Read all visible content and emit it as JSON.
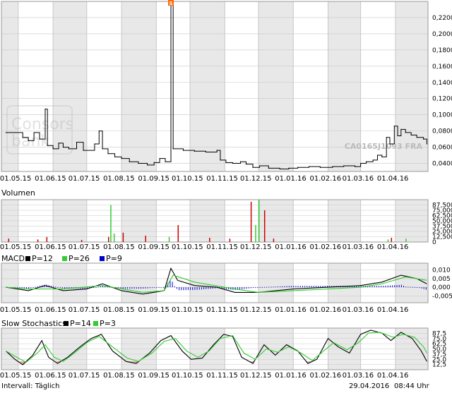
{
  "watermark": {
    "brand_line1": "Consors",
    "brand_line2": "bank",
    "security_id": "CA0165J1093 FRA"
  },
  "x_axis": {
    "labels": [
      "01.05.15",
      "01.06.15",
      "01.07.15",
      "01.08.15",
      "01.09.15",
      "01.10.15",
      "01.11.15",
      "01.12.15",
      "01.01.16",
      "01.02.16",
      "01.03.16",
      "01.04.16"
    ]
  },
  "footer": {
    "interval": "Intervall: Täglich",
    "date": "29.04.2016",
    "time": "08:44 Uhr"
  },
  "colors": {
    "band": "#e8e8e8",
    "grid": "#c8c8c8",
    "price": "#000000",
    "volume": "#cc0000",
    "volume_alt": "#33cc33",
    "macd": "#000000",
    "macd_signal": "#33cc33",
    "macd_hist": "#0000cc",
    "stoch_fill": "#ddaaaa",
    "event_marker": "#ff6600"
  },
  "chart_data": [
    {
      "type": "line",
      "panel": "price",
      "ylim": [
        0.03,
        0.24
      ],
      "y_ticks": [
        "0,2200",
        "0,2000",
        "0,1800",
        "0,1600",
        "0,1400",
        "0,1200",
        "0,1000",
        "0,0800",
        "0,0600",
        "0,0400"
      ],
      "event_marker": {
        "label": "S",
        "x": "2015-09-14"
      },
      "series": [
        {
          "x": "2015-04-20",
          "y": 0.078
        },
        {
          "x": "2015-05-05",
          "y": 0.072
        },
        {
          "x": "2015-05-10",
          "y": 0.068
        },
        {
          "x": "2015-05-15",
          "y": 0.078
        },
        {
          "x": "2015-05-20",
          "y": 0.07
        },
        {
          "x": "2015-05-25",
          "y": 0.107
        },
        {
          "x": "2015-05-27",
          "y": 0.062
        },
        {
          "x": "2015-06-01",
          "y": 0.058
        },
        {
          "x": "2015-06-06",
          "y": 0.065
        },
        {
          "x": "2015-06-10",
          "y": 0.06
        },
        {
          "x": "2015-06-15",
          "y": 0.058
        },
        {
          "x": "2015-06-22",
          "y": 0.066
        },
        {
          "x": "2015-06-28",
          "y": 0.056
        },
        {
          "x": "2015-07-08",
          "y": 0.064
        },
        {
          "x": "2015-07-12",
          "y": 0.08
        },
        {
          "x": "2015-07-15",
          "y": 0.058
        },
        {
          "x": "2015-07-20",
          "y": 0.052
        },
        {
          "x": "2015-07-26",
          "y": 0.048
        },
        {
          "x": "2015-08-01",
          "y": 0.046
        },
        {
          "x": "2015-08-08",
          "y": 0.042
        },
        {
          "x": "2015-08-16",
          "y": 0.04
        },
        {
          "x": "2015-08-24",
          "y": 0.038
        },
        {
          "x": "2015-08-30",
          "y": 0.041
        },
        {
          "x": "2015-09-04",
          "y": 0.046
        },
        {
          "x": "2015-09-09",
          "y": 0.042
        },
        {
          "x": "2015-09-14",
          "y": 0.236
        },
        {
          "x": "2015-09-16",
          "y": 0.058
        },
        {
          "x": "2015-09-25",
          "y": 0.056
        },
        {
          "x": "2015-10-05",
          "y": 0.055
        },
        {
          "x": "2015-10-15",
          "y": 0.054
        },
        {
          "x": "2015-10-25",
          "y": 0.056
        },
        {
          "x": "2015-10-28",
          "y": 0.044
        },
        {
          "x": "2015-11-02",
          "y": 0.041
        },
        {
          "x": "2015-11-08",
          "y": 0.04
        },
        {
          "x": "2015-11-15",
          "y": 0.042
        },
        {
          "x": "2015-11-20",
          "y": 0.039
        },
        {
          "x": "2015-11-26",
          "y": 0.035
        },
        {
          "x": "2015-12-02",
          "y": 0.037
        },
        {
          "x": "2015-12-10",
          "y": 0.034
        },
        {
          "x": "2015-12-20",
          "y": 0.033
        },
        {
          "x": "2015-12-28",
          "y": 0.034
        },
        {
          "x": "2016-01-05",
          "y": 0.035
        },
        {
          "x": "2016-01-15",
          "y": 0.036
        },
        {
          "x": "2016-01-25",
          "y": 0.035
        },
        {
          "x": "2016-02-05",
          "y": 0.036
        },
        {
          "x": "2016-02-15",
          "y": 0.037
        },
        {
          "x": "2016-02-25",
          "y": 0.036
        },
        {
          "x": "2016-03-01",
          "y": 0.04
        },
        {
          "x": "2016-03-06",
          "y": 0.042
        },
        {
          "x": "2016-03-12",
          "y": 0.044
        },
        {
          "x": "2016-03-16",
          "y": 0.05
        },
        {
          "x": "2016-03-20",
          "y": 0.048
        },
        {
          "x": "2016-03-24",
          "y": 0.072
        },
        {
          "x": "2016-03-27",
          "y": 0.064
        },
        {
          "x": "2016-03-31",
          "y": 0.086
        },
        {
          "x": "2016-04-03",
          "y": 0.074
        },
        {
          "x": "2016-04-06",
          "y": 0.082
        },
        {
          "x": "2016-04-10",
          "y": 0.078
        },
        {
          "x": "2016-04-15",
          "y": 0.075
        },
        {
          "x": "2016-04-20",
          "y": 0.072
        },
        {
          "x": "2016-04-26",
          "y": 0.07
        },
        {
          "x": "2016-04-29",
          "y": 0.064
        }
      ]
    },
    {
      "type": "bar",
      "panel": "volume",
      "title": "Volumen",
      "ylim": [
        0,
        100000
      ],
      "y_ticks": [
        "87,500",
        "75,000",
        "62,500",
        "50,000",
        "37,500",
        "25,000",
        "12,500",
        "0"
      ],
      "bars": [
        {
          "x": "2015-04-22",
          "v": 8000,
          "c": "red"
        },
        {
          "x": "2015-05-18",
          "v": 6000,
          "c": "red"
        },
        {
          "x": "2015-05-26",
          "v": 12000,
          "c": "red"
        },
        {
          "x": "2015-06-26",
          "v": 5000,
          "c": "red"
        },
        {
          "x": "2015-07-20",
          "v": 12000,
          "c": "red"
        },
        {
          "x": "2015-07-22",
          "v": 87500,
          "c": "green"
        },
        {
          "x": "2015-07-25",
          "v": 20000,
          "c": "green"
        },
        {
          "x": "2015-08-02",
          "v": 22000,
          "c": "red"
        },
        {
          "x": "2015-08-22",
          "v": 15000,
          "c": "red"
        },
        {
          "x": "2015-09-12",
          "v": 12000,
          "c": "green"
        },
        {
          "x": "2015-09-20",
          "v": 40000,
          "c": "red"
        },
        {
          "x": "2015-10-18",
          "v": 10000,
          "c": "red"
        },
        {
          "x": "2015-11-05",
          "v": 8000,
          "c": "red"
        },
        {
          "x": "2015-11-24",
          "v": 95000,
          "c": "red"
        },
        {
          "x": "2015-11-28",
          "v": 40000,
          "c": "green"
        },
        {
          "x": "2015-12-01",
          "v": 118000,
          "c": "green"
        },
        {
          "x": "2015-12-06",
          "v": 75000,
          "c": "red"
        },
        {
          "x": "2015-12-14",
          "v": 8000,
          "c": "red"
        },
        {
          "x": "2016-03-25",
          "v": 6000,
          "c": "green"
        },
        {
          "x": "2016-03-28",
          "v": 10000,
          "c": "red"
        },
        {
          "x": "2016-04-10",
          "v": 8000,
          "c": "green"
        }
      ]
    },
    {
      "type": "line",
      "panel": "macd",
      "title": "MACD",
      "legend": [
        {
          "name": "P=12",
          "color": "#000000"
        },
        {
          "name": "P=26",
          "color": "#33cc33"
        },
        {
          "name": "P=9",
          "color": "#0000cc"
        }
      ],
      "ylim": [
        -0.009,
        0.014
      ],
      "y_ticks": [
        "0,010",
        "0,005",
        "0,000",
        "-0,005"
      ],
      "series": [
        {
          "name": "P=12",
          "color": "#000000",
          "points": [
            {
              "x": "2015-04-20",
              "y": 0.0
            },
            {
              "x": "2015-05-10",
              "y": -0.002
            },
            {
              "x": "2015-05-25",
              "y": 0.001
            },
            {
              "x": "2015-06-10",
              "y": -0.002
            },
            {
              "x": "2015-07-01",
              "y": -0.001
            },
            {
              "x": "2015-07-15",
              "y": 0.002
            },
            {
              "x": "2015-08-01",
              "y": -0.002
            },
            {
              "x": "2015-08-20",
              "y": -0.004
            },
            {
              "x": "2015-09-08",
              "y": -0.002
            },
            {
              "x": "2015-09-14",
              "y": 0.011
            },
            {
              "x": "2015-09-20",
              "y": 0.004
            },
            {
              "x": "2015-10-05",
              "y": 0.001
            },
            {
              "x": "2015-10-25",
              "y": 0.0
            },
            {
              "x": "2015-11-10",
              "y": -0.003
            },
            {
              "x": "2015-12-01",
              "y": -0.003
            },
            {
              "x": "2016-01-01",
              "y": -0.001
            },
            {
              "x": "2016-02-01",
              "y": 0.0
            },
            {
              "x": "2016-03-01",
              "y": 0.001
            },
            {
              "x": "2016-03-20",
              "y": 0.003
            },
            {
              "x": "2016-04-06",
              "y": 0.007
            },
            {
              "x": "2016-04-20",
              "y": 0.005
            },
            {
              "x": "2016-04-29",
              "y": 0.002
            }
          ]
        },
        {
          "name": "P=26",
          "color": "#33cc33",
          "points": [
            {
              "x": "2015-04-20",
              "y": 0.0
            },
            {
              "x": "2015-05-10",
              "y": -0.001
            },
            {
              "x": "2015-06-10",
              "y": -0.001
            },
            {
              "x": "2015-07-15",
              "y": 0.001
            },
            {
              "x": "2015-08-20",
              "y": -0.003
            },
            {
              "x": "2015-09-08",
              "y": -0.002
            },
            {
              "x": "2015-09-16",
              "y": 0.007
            },
            {
              "x": "2015-10-05",
              "y": 0.003
            },
            {
              "x": "2015-11-10",
              "y": -0.001
            },
            {
              "x": "2015-12-01",
              "y": -0.003
            },
            {
              "x": "2016-01-01",
              "y": -0.002
            },
            {
              "x": "2016-02-01",
              "y": -0.001
            },
            {
              "x": "2016-03-01",
              "y": 0.0
            },
            {
              "x": "2016-03-20",
              "y": 0.002
            },
            {
              "x": "2016-04-10",
              "y": 0.006
            },
            {
              "x": "2016-04-29",
              "y": 0.004
            }
          ]
        }
      ]
    },
    {
      "type": "line",
      "panel": "stochastics",
      "title": "Slow Stochastics",
      "legend": [
        {
          "name": "P=14",
          "color": "#000000"
        },
        {
          "name": "P=3",
          "color": "#33cc33"
        }
      ],
      "ylim": [
        0,
        100
      ],
      "y_ticks": [
        "87,5",
        "75,0",
        "62,5",
        "50,0",
        "37,5",
        "25,0",
        "12,5"
      ],
      "series": [
        {
          "name": "P=14",
          "color": "#000000",
          "points": [
            {
              "x": "2015-04-20",
              "y": 45
            },
            {
              "x": "2015-04-28",
              "y": 25
            },
            {
              "x": "2015-05-05",
              "y": 12
            },
            {
              "x": "2015-05-14",
              "y": 35
            },
            {
              "x": "2015-05-22",
              "y": 70
            },
            {
              "x": "2015-05-28",
              "y": 30
            },
            {
              "x": "2015-06-05",
              "y": 15
            },
            {
              "x": "2015-06-14",
              "y": 30
            },
            {
              "x": "2015-06-25",
              "y": 55
            },
            {
              "x": "2015-07-05",
              "y": 75
            },
            {
              "x": "2015-07-14",
              "y": 85
            },
            {
              "x": "2015-07-24",
              "y": 45
            },
            {
              "x": "2015-08-05",
              "y": 20
            },
            {
              "x": "2015-08-14",
              "y": 15
            },
            {
              "x": "2015-08-26",
              "y": 40
            },
            {
              "x": "2015-09-05",
              "y": 70
            },
            {
              "x": "2015-09-14",
              "y": 82
            },
            {
              "x": "2015-09-24",
              "y": 45
            },
            {
              "x": "2015-10-02",
              "y": 25
            },
            {
              "x": "2015-10-12",
              "y": 28
            },
            {
              "x": "2015-10-22",
              "y": 60
            },
            {
              "x": "2015-10-31",
              "y": 85
            },
            {
              "x": "2015-11-08",
              "y": 80
            },
            {
              "x": "2015-11-16",
              "y": 30
            },
            {
              "x": "2015-11-26",
              "y": 15
            },
            {
              "x": "2015-12-06",
              "y": 60
            },
            {
              "x": "2015-12-16",
              "y": 35
            },
            {
              "x": "2015-12-26",
              "y": 60
            },
            {
              "x": "2016-01-05",
              "y": 45
            },
            {
              "x": "2016-01-14",
              "y": 15
            },
            {
              "x": "2016-01-22",
              "y": 25
            },
            {
              "x": "2016-02-01",
              "y": 75
            },
            {
              "x": "2016-02-10",
              "y": 55
            },
            {
              "x": "2016-02-20",
              "y": 40
            },
            {
              "x": "2016-03-01",
              "y": 85
            },
            {
              "x": "2016-03-10",
              "y": 95
            },
            {
              "x": "2016-03-20",
              "y": 88
            },
            {
              "x": "2016-03-28",
              "y": 70
            },
            {
              "x": "2016-04-06",
              "y": 90
            },
            {
              "x": "2016-04-16",
              "y": 75
            },
            {
              "x": "2016-04-24",
              "y": 45
            },
            {
              "x": "2016-04-29",
              "y": 20
            }
          ]
        },
        {
          "name": "P=3",
          "color": "#33cc33",
          "points": [
            {
              "x": "2015-04-20",
              "y": 45
            },
            {
              "x": "2015-05-01",
              "y": 28
            },
            {
              "x": "2015-05-08",
              "y": 18
            },
            {
              "x": "2015-05-18",
              "y": 40
            },
            {
              "x": "2015-05-25",
              "y": 60
            },
            {
              "x": "2015-06-02",
              "y": 30
            },
            {
              "x": "2015-06-10",
              "y": 20
            },
            {
              "x": "2015-06-20",
              "y": 40
            },
            {
              "x": "2015-07-01",
              "y": 65
            },
            {
              "x": "2015-07-12",
              "y": 80
            },
            {
              "x": "2015-07-24",
              "y": 55
            },
            {
              "x": "2015-08-06",
              "y": 28
            },
            {
              "x": "2015-08-16",
              "y": 20
            },
            {
              "x": "2015-08-28",
              "y": 40
            },
            {
              "x": "2015-09-08",
              "y": 68
            },
            {
              "x": "2015-09-18",
              "y": 75
            },
            {
              "x": "2015-09-28",
              "y": 45
            },
            {
              "x": "2015-10-08",
              "y": 30
            },
            {
              "x": "2015-10-18",
              "y": 45
            },
            {
              "x": "2015-10-28",
              "y": 75
            },
            {
              "x": "2015-11-08",
              "y": 82
            },
            {
              "x": "2015-11-18",
              "y": 40
            },
            {
              "x": "2015-11-28",
              "y": 25
            },
            {
              "x": "2015-12-08",
              "y": 50
            },
            {
              "x": "2015-12-18",
              "y": 42
            },
            {
              "x": "2015-12-28",
              "y": 55
            },
            {
              "x": "2016-01-08",
              "y": 40
            },
            {
              "x": "2016-01-18",
              "y": 22
            },
            {
              "x": "2016-01-28",
              "y": 45
            },
            {
              "x": "2016-02-06",
              "y": 65
            },
            {
              "x": "2016-02-18",
              "y": 48
            },
            {
              "x": "2016-02-28",
              "y": 65
            },
            {
              "x": "2016-03-08",
              "y": 88
            },
            {
              "x": "2016-03-18",
              "y": 90
            },
            {
              "x": "2016-03-30",
              "y": 78
            },
            {
              "x": "2016-04-08",
              "y": 85
            },
            {
              "x": "2016-04-18",
              "y": 78
            },
            {
              "x": "2016-04-26",
              "y": 55
            },
            {
              "x": "2016-04-29",
              "y": 40
            }
          ]
        }
      ]
    }
  ]
}
